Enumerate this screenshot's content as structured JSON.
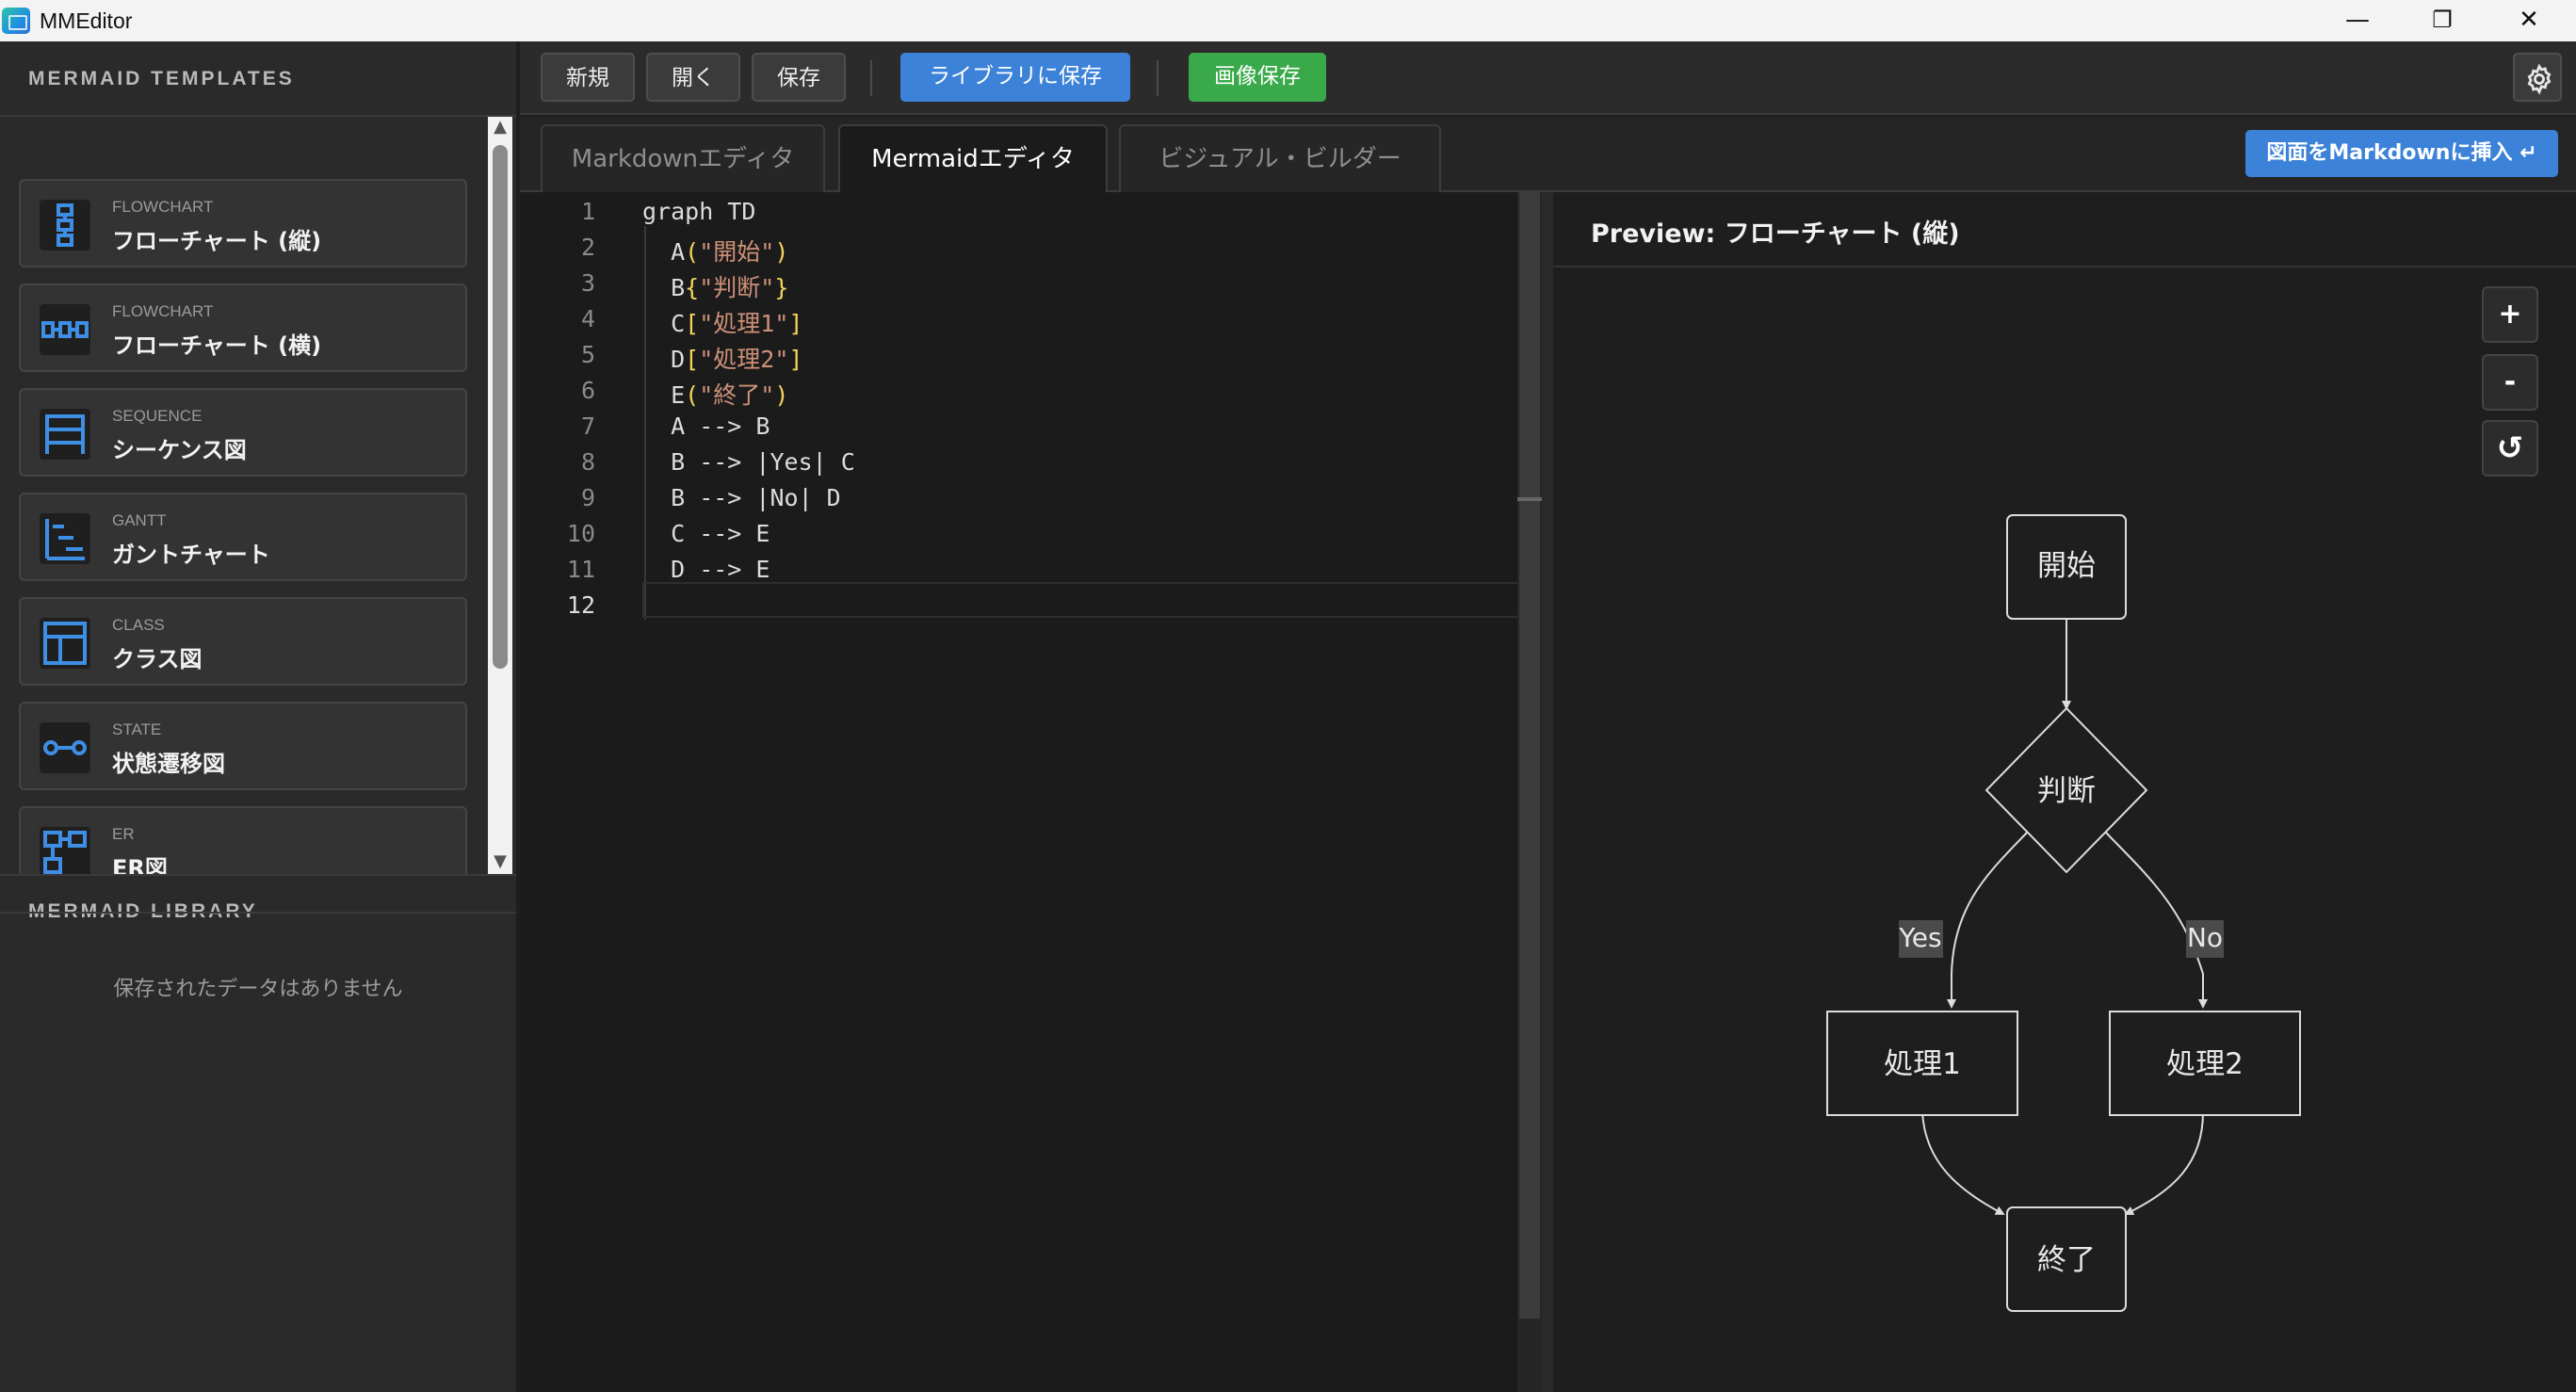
{
  "app": {
    "title": "MMEditor"
  },
  "window_controls": {
    "minimize": "—",
    "maximize": "❐",
    "close": "✕"
  },
  "sidebar": {
    "templates_heading": "MERMAID TEMPLATES",
    "library_heading": "MERMAID LIBRARY",
    "library_empty": "保存されたデータはありません",
    "templates": [
      {
        "category": "FLOWCHART",
        "name": "フローチャート (縦)",
        "icon": "flowchart-vertical-icon"
      },
      {
        "category": "FLOWCHART",
        "name": "フローチャート (横)",
        "icon": "flowchart-horizontal-icon"
      },
      {
        "category": "SEQUENCE",
        "name": "シーケンス図",
        "icon": "sequence-icon"
      },
      {
        "category": "GANTT",
        "name": "ガントチャート",
        "icon": "gantt-icon"
      },
      {
        "category": "CLASS",
        "name": "クラス図",
        "icon": "class-icon"
      },
      {
        "category": "STATE",
        "name": "状態遷移図",
        "icon": "state-icon"
      },
      {
        "category": "ER",
        "name": "ER図",
        "icon": "er-icon"
      }
    ]
  },
  "toolbar": {
    "new_label": "新規",
    "open_label": "開く",
    "save_label": "保存",
    "save_library_label": "ライブラリに保存",
    "save_image_label": "画像保存",
    "settings_icon": "gear-icon"
  },
  "tabs": {
    "markdown": "Markdownエディタ",
    "mermaid": "Mermaidエディタ",
    "visual": "ビジュアル・ビルダー",
    "active": "mermaid",
    "insert_label": "図面をMarkdownに挿入 ↵"
  },
  "editor": {
    "current_line": 12,
    "line_numbers": [
      "1",
      "2",
      "3",
      "4",
      "5",
      "6",
      "7",
      "8",
      "9",
      "10",
      "11",
      "12"
    ],
    "lines": [
      "graph TD",
      "  A(\"開始\")",
      "  B{\"判断\"}",
      "  C[\"処理1\"]",
      "  D[\"処理2\"]",
      "  E(\"終了\")",
      "  A --> B",
      "  B --> |Yes| C",
      "  B --> |No| D",
      "  C --> E",
      "  D --> E",
      ""
    ]
  },
  "preview": {
    "title": "Preview: フローチャート (縦)",
    "zoom_in": "+",
    "zoom_out": "-",
    "reset": "↺",
    "nodes": {
      "A": "開始",
      "B": "判断",
      "C": "処理1",
      "D": "処理2",
      "E": "終了"
    },
    "edge_labels": {
      "yes": "Yes",
      "no": "No"
    }
  },
  "colors": {
    "accent_blue": "#3b82d8",
    "accent_green": "#3aa94a",
    "icon_blue": "#3f8ee6"
  }
}
